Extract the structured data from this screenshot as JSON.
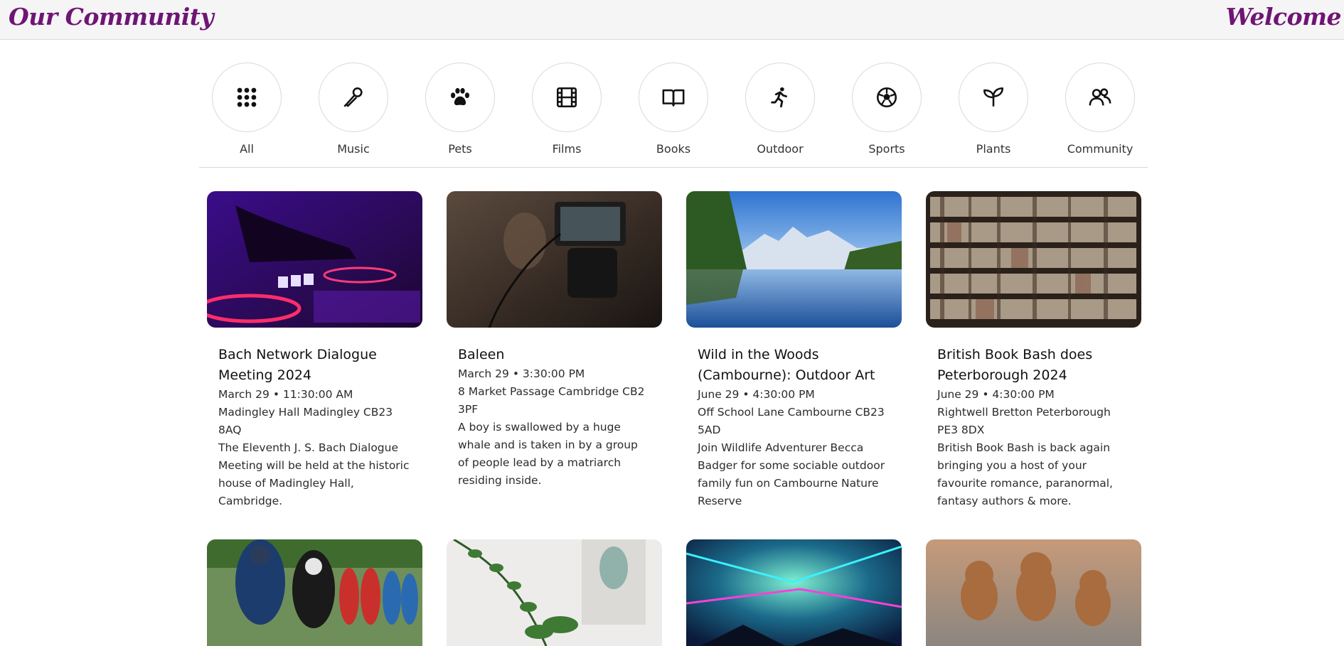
{
  "header": {
    "brand": "Our Community",
    "welcome": "Welcome"
  },
  "categories": [
    {
      "label": "All",
      "icon": "grid-icon"
    },
    {
      "label": "Music",
      "icon": "microphone-icon"
    },
    {
      "label": "Pets",
      "icon": "paw-icon"
    },
    {
      "label": "Films",
      "icon": "film-icon"
    },
    {
      "label": "Books",
      "icon": "book-icon"
    },
    {
      "label": "Outdoor",
      "icon": "running-icon"
    },
    {
      "label": "Sports",
      "icon": "football-icon"
    },
    {
      "label": "Plants",
      "icon": "sprout-icon"
    },
    {
      "label": "Community",
      "icon": "people-icon"
    }
  ],
  "events": [
    {
      "title": "Bach Network Dialogue Meeting 2024",
      "date": "March 29 • 11:30:00 AM",
      "location": "Madingley Hall Madingley CB23 8AQ",
      "description": "The Eleventh J. S. Bach Dialogue Meeting will be held at the historic house of Madingley Hall, Cambridge."
    },
    {
      "title": "Baleen",
      "date": "March 29 • 3:30:00 PM",
      "location": "8 Market Passage Cambridge CB2 3PF",
      "description": "A boy is swallowed by a huge whale and is taken in by a group of people lead by a matriarch residing inside."
    },
    {
      "title": "Wild in the Woods (Cambourne): Outdoor Art",
      "date": "June 29 • 4:30:00 PM",
      "location": "Off School Lane Cambourne CB23 5AD",
      "description": "Join Wildlife Adventurer Becca Badger for some sociable outdoor family fun on Cambourne Nature Reserve"
    },
    {
      "title": "British Book Bash does Peterborough 2024",
      "date": "June 29 • 4:30:00 PM",
      "location": "Rightwell Bretton Peterborough PE3 8DX",
      "description": "British Book Bash is back again bringing you a host of your favourite romance, paranormal, fantasy authors & more."
    }
  ],
  "colors": {
    "brand": "#6f1574",
    "header_bg": "#f5f5f6"
  }
}
